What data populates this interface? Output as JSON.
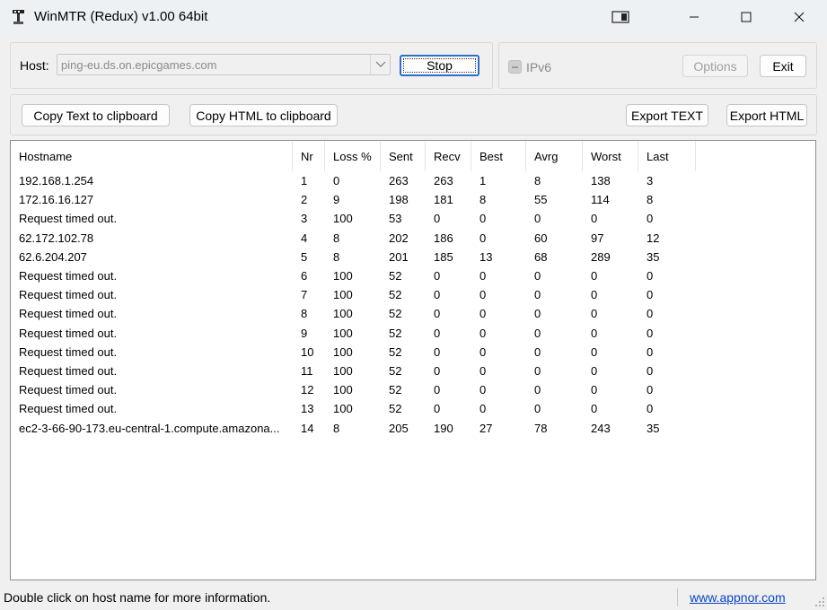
{
  "window": {
    "title": "WinMTR (Redux) v1.00 64bit"
  },
  "host": {
    "label": "Host:",
    "value": "ping-eu.ds.on.epicgames.com",
    "stop_label": "Stop"
  },
  "ipv6": {
    "label": "IPv6",
    "checked": false
  },
  "buttons": {
    "options": "Options",
    "exit": "Exit",
    "copy_text": "Copy Text to clipboard",
    "copy_html": "Copy HTML to clipboard",
    "export_text": "Export TEXT",
    "export_html": "Export HTML"
  },
  "table": {
    "columns": [
      "Hostname",
      "Nr",
      "Loss %",
      "Sent",
      "Recv",
      "Best",
      "Avrg",
      "Worst",
      "Last"
    ],
    "rows": [
      [
        "192.168.1.254",
        "1",
        "0",
        "263",
        "263",
        "1",
        "8",
        "138",
        "3"
      ],
      [
        "172.16.16.127",
        "2",
        "9",
        "198",
        "181",
        "8",
        "55",
        "114",
        "8"
      ],
      [
        "Request timed out.",
        "3",
        "100",
        "53",
        "0",
        "0",
        "0",
        "0",
        "0"
      ],
      [
        "62.172.102.78",
        "4",
        "8",
        "202",
        "186",
        "0",
        "60",
        "97",
        "12"
      ],
      [
        "62.6.204.207",
        "5",
        "8",
        "201",
        "185",
        "13",
        "68",
        "289",
        "35"
      ],
      [
        "Request timed out.",
        "6",
        "100",
        "52",
        "0",
        "0",
        "0",
        "0",
        "0"
      ],
      [
        "Request timed out.",
        "7",
        "100",
        "52",
        "0",
        "0",
        "0",
        "0",
        "0"
      ],
      [
        "Request timed out.",
        "8",
        "100",
        "52",
        "0",
        "0",
        "0",
        "0",
        "0"
      ],
      [
        "Request timed out.",
        "9",
        "100",
        "52",
        "0",
        "0",
        "0",
        "0",
        "0"
      ],
      [
        "Request timed out.",
        "10",
        "100",
        "52",
        "0",
        "0",
        "0",
        "0",
        "0"
      ],
      [
        "Request timed out.",
        "11",
        "100",
        "52",
        "0",
        "0",
        "0",
        "0",
        "0"
      ],
      [
        "Request timed out.",
        "12",
        "100",
        "52",
        "0",
        "0",
        "0",
        "0",
        "0"
      ],
      [
        "Request timed out.",
        "13",
        "100",
        "52",
        "0",
        "0",
        "0",
        "0",
        "0"
      ],
      [
        "ec2-3-66-90-173.eu-central-1.compute.amazona...",
        "14",
        "8",
        "205",
        "190",
        "27",
        "78",
        "243",
        "35"
      ]
    ]
  },
  "status": {
    "text": "Double click on host name for more information.",
    "link": "www.appnor.com"
  },
  "icons": {
    "app": "winmtr-app-icon",
    "snap": "snap-layout-icon",
    "minimize": "minimize-icon",
    "maximize": "maximize-icon",
    "close": "close-icon",
    "dropdown": "chevron-down-icon"
  }
}
